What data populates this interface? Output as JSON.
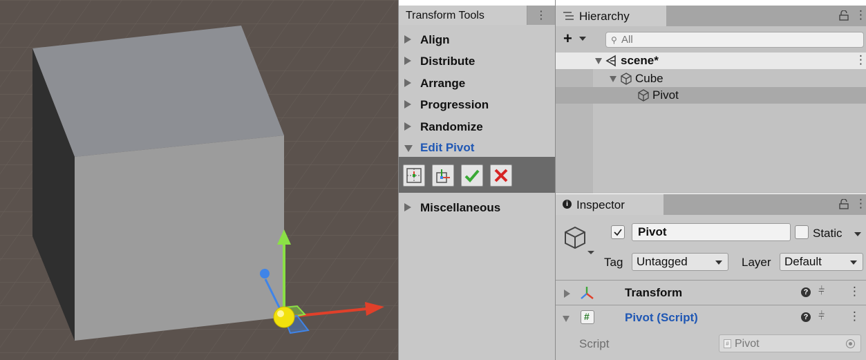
{
  "scene": {
    "colors": {
      "ground": "#5b524d",
      "cube_top": "#8d8f94",
      "cube_front": "#9d9d9d",
      "cube_side": "#333333",
      "axis_x": "#e0402a",
      "axis_y": "#8be046",
      "axis_z": "#3f84e8",
      "pivot": "#f2e10d"
    }
  },
  "tools": {
    "tab_title": "Transform Tools",
    "items": [
      {
        "label": "Align",
        "expanded": false
      },
      {
        "label": "Distribute",
        "expanded": false
      },
      {
        "label": "Arrange",
        "expanded": false
      },
      {
        "label": "Progression",
        "expanded": false
      },
      {
        "label": "Randomize",
        "expanded": false
      },
      {
        "label": "Edit Pivot",
        "expanded": true
      },
      {
        "label": "Miscellaneous",
        "expanded": false
      }
    ],
    "pivot_buttons": [
      "pivot-center-icon",
      "pivot-move-icon",
      "checkmark-icon",
      "cancel-x-icon"
    ]
  },
  "hierarchy": {
    "tab_title": "Hierarchy",
    "search_placeholder": "All",
    "rows": [
      {
        "name": "scene*",
        "icon": "unity-scene-icon"
      },
      {
        "name": "Cube",
        "icon": "cube-icon"
      },
      {
        "name": "Pivot",
        "icon": "cube-icon"
      }
    ]
  },
  "inspector": {
    "tab_title": "Inspector",
    "object_name": "Pivot",
    "static_label": "Static",
    "tag_label": "Tag",
    "tag_value": "Untagged",
    "layer_label": "Layer",
    "layer_value": "Default",
    "components": [
      {
        "name": "Transform",
        "expanded": false
      },
      {
        "name": "Pivot (Script)",
        "expanded": true
      }
    ],
    "script_label": "Script",
    "script_value": "Pivot",
    "colors": {
      "accent": "#1f57b4"
    }
  }
}
